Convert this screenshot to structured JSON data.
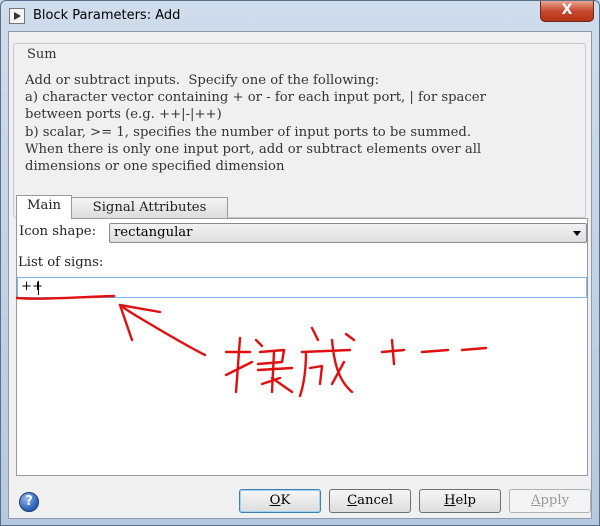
{
  "window": {
    "title": "Block Parameters: Add",
    "close_glyph": "X"
  },
  "block": {
    "name": "Sum",
    "description_lines": [
      "Add or subtract inputs.  Specify one of the following:",
      "a) character vector containing + or - for each input port, | for spacer",
      "between ports (e.g. ++|-|++)",
      "b) scalar, >= 1, specifies the number of input ports to be summed.",
      "When there is only one input port, add or subtract elements over all",
      "dimensions or one specified dimension"
    ]
  },
  "tabs": [
    {
      "label": "Main",
      "active": true
    },
    {
      "label": "Signal Attributes",
      "active": false
    }
  ],
  "main": {
    "icon_shape_label": "Icon shape:",
    "icon_shape_value": "rectangular",
    "list_of_signs_label": "List of signs:",
    "list_of_signs_value": "++"
  },
  "buttons": {
    "ok": {
      "mnemonic": "O",
      "rest": "K"
    },
    "cancel": {
      "mnemonic": "C",
      "rest": "ancel"
    },
    "help": {
      "mnemonic": "H",
      "rest": "elp"
    },
    "apply": {
      "mnemonic": "A",
      "rest": "pply",
      "disabled": true
    }
  },
  "annotation": {
    "ink_color": "#e01010",
    "note": "换成+--"
  },
  "colors": {
    "accent": "#3c7fb1",
    "input_border": "#7eb4ea",
    "close_button": "#c8492e"
  }
}
